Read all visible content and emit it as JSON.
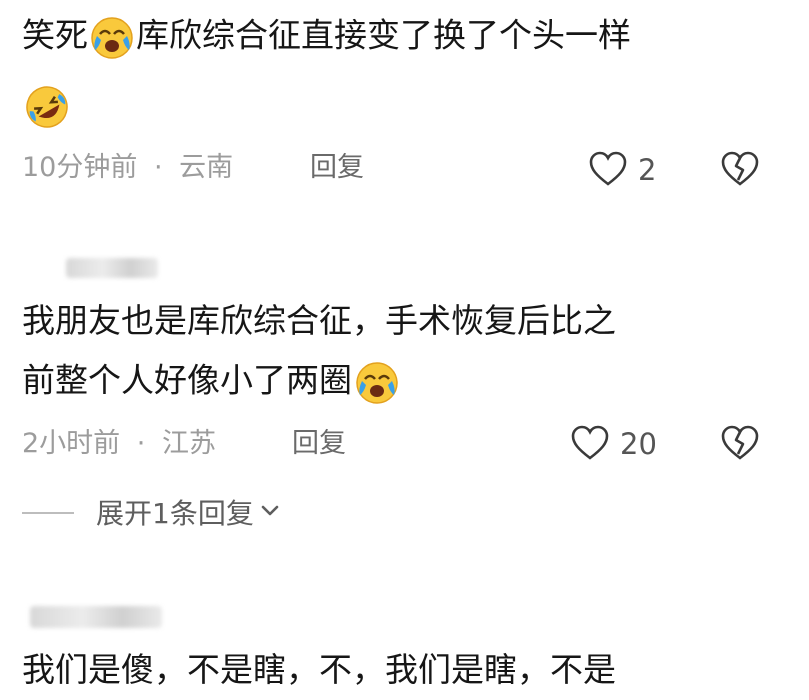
{
  "comments": [
    {
      "text_before": "笑死",
      "text_after": "库欣综合征直接变了换了个头一样",
      "time": "10分钟前",
      "location": "云南",
      "reply_label": "回复",
      "likes": "2",
      "emoji_names": [
        "crying-laughing-emoji",
        "rolling-laughing-emoji"
      ]
    },
    {
      "line1": "我朋友也是库欣综合征，手术恢复后比之",
      "line2": "前整个人好像小了两圈",
      "time": "2小时前",
      "location": "江苏",
      "reply_label": "回复",
      "likes": "20",
      "expand_label": "展开1条回复",
      "emoji_names": [
        "crying-laughing-emoji"
      ]
    },
    {
      "line1": "我们是傻，不是瞎，不，我们是瞎，不是"
    }
  ],
  "separator": "·",
  "colors": {
    "meta": "#9c9c9c",
    "text": "#161616",
    "emoji_face": "#f9c93c",
    "tears": "#3aa0e8"
  }
}
